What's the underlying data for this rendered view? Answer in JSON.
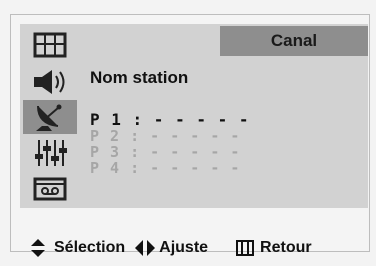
{
  "menu": {
    "title": "Canal",
    "subtitle": "Nom station",
    "icons": [
      {
        "name": "picture-icon",
        "active": false
      },
      {
        "name": "sound-icon",
        "active": false
      },
      {
        "name": "channel-icon",
        "active": true
      },
      {
        "name": "setup-icon",
        "active": false
      },
      {
        "name": "input-icon",
        "active": false
      }
    ],
    "presets": [
      {
        "label": "P 1 : - - - - -",
        "selected": true
      },
      {
        "label": "P 2 : - - - - -",
        "selected": false
      },
      {
        "label": "P 3 : - - - - -",
        "selected": false
      },
      {
        "label": "P 4 : - - - - -",
        "selected": false
      }
    ]
  },
  "footer": {
    "select_label": "Sélection",
    "adjust_label": "Ajuste",
    "return_label": "Retour",
    "select_icon": "up-down-arrows-icon",
    "adjust_icon": "left-right-arrows-icon",
    "return_icon": "menu-icon"
  },
  "colors": {
    "panel": "#d2d2d2",
    "active": "#8e8e8e",
    "dim_text": "#a6a6a6",
    "text": "#111111"
  }
}
